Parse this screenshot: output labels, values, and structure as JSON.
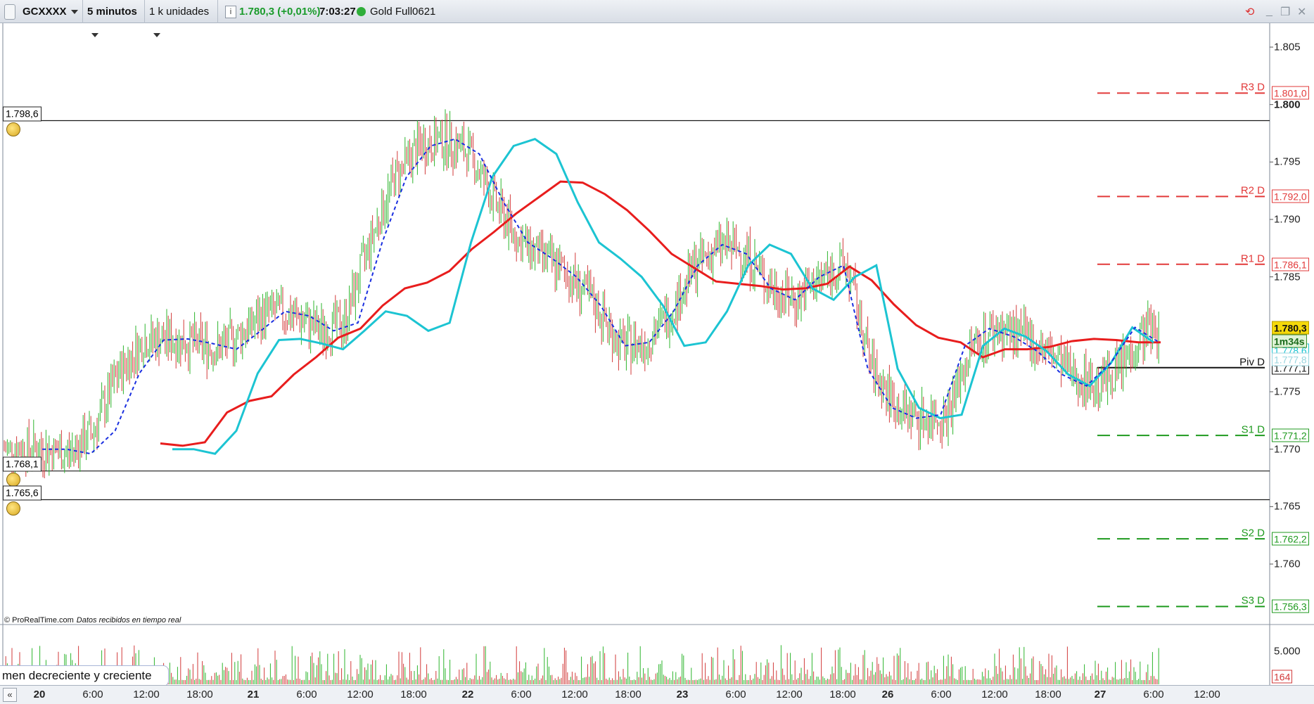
{
  "toolbar": {
    "symbol": "GCXXXX",
    "timeframe": "5 minutos",
    "units": "1 k unidades",
    "last_price_change": "1.780,3 (+0,01%)",
    "time": "7:03:27",
    "instrument": "Gold Full0621"
  },
  "credit": {
    "source": "© ProRealTime.com",
    "note": "Datos recibidos en tiempo real"
  },
  "volume_panel": {
    "label": "men decreciente y creciente",
    "axis_label": "5.000",
    "last_value": "164"
  },
  "colors": {
    "ma_red": "#e81d1d",
    "ma_cyan": "#1cc4d2",
    "ma_gray": "#9a9a9a",
    "ma_blue": "#1a2fe0",
    "up": "#2db52d",
    "down": "#d23a3a",
    "resistance": "#e23a3a",
    "support": "#1f9a1f"
  },
  "chart_data": {
    "type": "candlestick",
    "y_ticks": [
      "1.805",
      "1.800",
      "1.795",
      "1.790",
      "1.785",
      "1.775",
      "1.770",
      "1.765",
      "1.760"
    ],
    "y_tick_values": [
      1805,
      1800,
      1795,
      1790,
      1785,
      1775,
      1770,
      1765,
      1760
    ],
    "ylim": [
      1753.5,
      1806.5
    ],
    "x_labels": [
      "20",
      "6:00",
      "12:00",
      "18:00",
      "21",
      "6:00",
      "12:00",
      "18:00",
      "22",
      "6:00",
      "12:00",
      "18:00",
      "23",
      "6:00",
      "12:00",
      "18:00",
      "26",
      "6:00",
      "12:00",
      "18:00",
      "27",
      "6:00",
      "12:00"
    ],
    "x_day_labels": [
      "20",
      "21",
      "22",
      "23",
      "26",
      "27"
    ],
    "pivots": [
      {
        "name": "R3 D",
        "value": 1801.0,
        "label": "1.801,0",
        "kind": "resistance"
      },
      {
        "name": "R2 D",
        "value": 1792.0,
        "label": "1.792,0",
        "kind": "resistance"
      },
      {
        "name": "R1 D",
        "value": 1786.1,
        "label": "1.786,1",
        "kind": "resistance"
      },
      {
        "name": "Piv D",
        "value": 1777.1,
        "label": "1.777,1",
        "kind": "pivot"
      },
      {
        "name": "S1 D",
        "value": 1771.2,
        "label": "1.771,2",
        "kind": "support"
      },
      {
        "name": "S2 D",
        "value": 1762.2,
        "label": "1.762,2",
        "kind": "support"
      },
      {
        "name": "S3 D",
        "value": 1756.3,
        "label": "1.756,3",
        "kind": "support"
      }
    ],
    "horizontal_lines": [
      {
        "label": "1.798,6",
        "value": 1798.6
      },
      {
        "label": "1.768,1",
        "value": 1768.1
      },
      {
        "label": "1.765,6",
        "value": 1765.6
      }
    ],
    "current": {
      "price_label": "1.780,3",
      "value": 1780.3,
      "countdown": "1m34s",
      "ma_labels": [
        "1.778,6",
        "1.777,8"
      ]
    },
    "series": [
      {
        "name": "red",
        "values": [
          1770.5,
          1770.3,
          1770.6,
          1773.2,
          1774.2,
          1774.6,
          1776.5,
          1778.0,
          1779.7,
          1780.5,
          1782.5,
          1784.0,
          1784.5,
          1785.5,
          1787.4,
          1788.9,
          1790.5,
          1791.9,
          1793.3,
          1793.2,
          1792.2,
          1790.8,
          1789.0,
          1787.0,
          1785.8,
          1784.6,
          1784.4,
          1784.2,
          1783.9,
          1784.0,
          1784.4,
          1785.9,
          1784.7,
          1782.6,
          1780.8,
          1779.7,
          1779.3,
          1778.0,
          1778.7,
          1778.7,
          1778.9,
          1779.4,
          1779.6,
          1779.5,
          1779.3,
          1779.3
        ]
      },
      {
        "name": "cyan",
        "values": [
          1770.0,
          1770.0,
          1769.6,
          1771.6,
          1776.6,
          1779.5,
          1779.6,
          1779.2,
          1778.7,
          1780.3,
          1782.0,
          1781.6,
          1780.3,
          1781.0,
          1788.0,
          1793.7,
          1796.4,
          1797.0,
          1795.7,
          1791.5,
          1788.0,
          1786.6,
          1785.0,
          1782.5,
          1779.0,
          1779.3,
          1782.0,
          1786.0,
          1787.8,
          1787.0,
          1784.0,
          1783.0,
          1785.0,
          1786.0,
          1777.0,
          1773.6,
          1772.7,
          1773.0,
          1779.0,
          1780.5,
          1779.8,
          1778.5,
          1776.5,
          1775.5,
          1777.5,
          1780.6,
          1779.3
        ]
      }
    ]
  }
}
